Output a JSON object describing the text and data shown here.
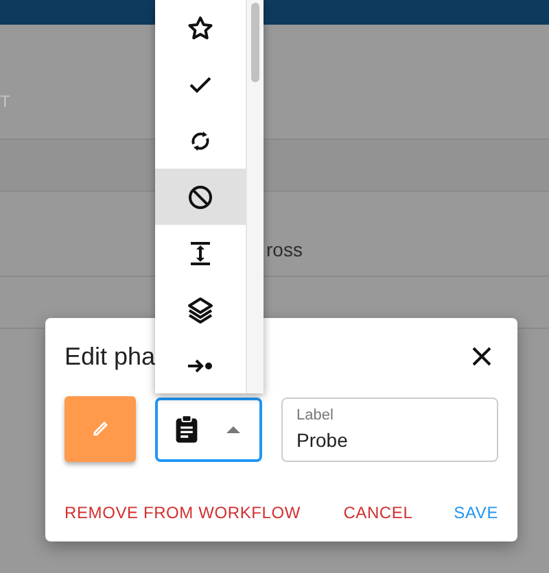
{
  "background": {
    "texts": [
      "T",
      "ross"
    ]
  },
  "icon_menu": {
    "items": [
      {
        "kind": "star",
        "selected": false
      },
      {
        "kind": "check",
        "selected": false
      },
      {
        "kind": "sync",
        "selected": false
      },
      {
        "kind": "block",
        "selected": true
      },
      {
        "kind": "height",
        "selected": false
      },
      {
        "kind": "layers",
        "selected": false
      },
      {
        "kind": "arrow-dot",
        "selected": false
      }
    ]
  },
  "dialog": {
    "title": "Edit pha",
    "color_button": {
      "color": "#ff9a4d"
    },
    "icon_select": {
      "kind": "clipboard",
      "expanded": true
    },
    "label_field": {
      "label": "Label",
      "value": "Probe"
    },
    "actions": [
      {
        "label": "REMOVE FROM WORKFLOW",
        "kind": "danger"
      },
      {
        "label": "CANCEL",
        "kind": "danger"
      },
      {
        "label": "SAVE",
        "kind": "primary"
      }
    ]
  }
}
